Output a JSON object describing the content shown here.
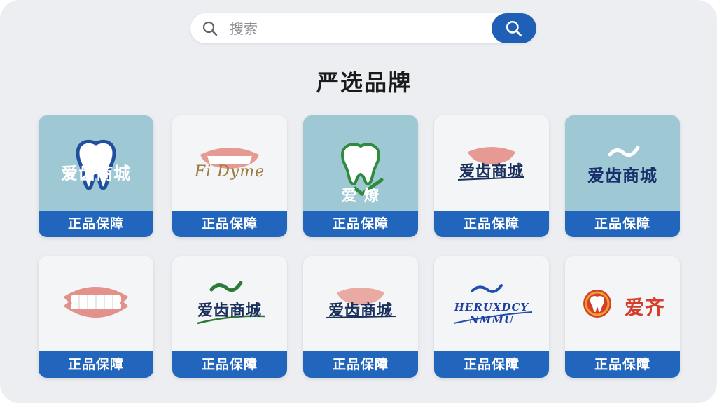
{
  "search": {
    "placeholder": "搜索"
  },
  "section": {
    "title": "严选品牌"
  },
  "brands": [
    {
      "logo_text": "爱齿商城",
      "badge": "正品保障"
    },
    {
      "logo_text": "Fi Dyme",
      "badge": "正品保障"
    },
    {
      "logo_text": "爱 燎",
      "badge": "正品保障"
    },
    {
      "logo_text": "爱齿商城",
      "badge": "正品保障"
    },
    {
      "logo_text": "爱齿商城",
      "badge": "正品保障"
    },
    {
      "logo_text": "",
      "badge": "正品保障"
    },
    {
      "logo_text": "爱齿商城",
      "badge": "正品保障"
    },
    {
      "logo_text": "爱齿商城",
      "badge": "正品保障"
    },
    {
      "logo_text": "HERUXDCY NMMU",
      "badge": "正品保障"
    },
    {
      "logo_text": "爱齐",
      "badge": "正品保障"
    }
  ],
  "colors": {
    "accent": "#2165bd",
    "background": "#eceef1",
    "teal": "#9ec9d4"
  }
}
